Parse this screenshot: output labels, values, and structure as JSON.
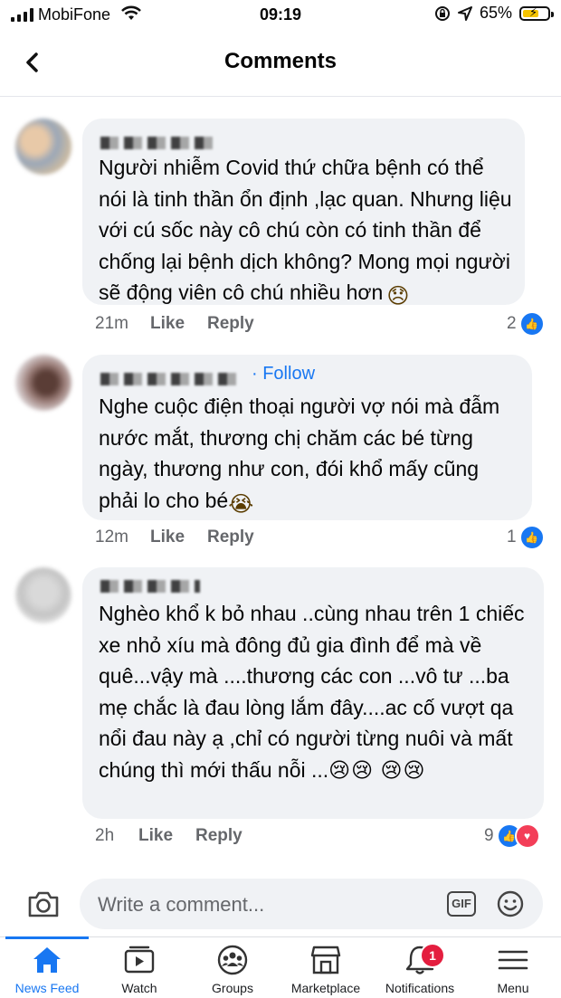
{
  "status_bar": {
    "carrier": "MobiFone",
    "time": "09:19",
    "battery": "65%",
    "battery_level": 0.65
  },
  "header": {
    "title": "Comments"
  },
  "comments": [
    {
      "text": "Người nhiễm Covid thứ chữa bệnh có thể nói là tinh thần ổn định ,lạc quan. Nhưng liệu với cú sốc này cô chú còn có tinh thần để chống lại bệnh dịch không? Mong mọi người sẽ động viên cô chú nhiều hơn",
      "emoji": "😞",
      "time": "21m",
      "like": "Like",
      "reply": "Reply",
      "reaction_count": "2",
      "reactions": [
        "like"
      ]
    },
    {
      "follow": "· Follow",
      "text": "Nghe cuộc điện thoại người vợ nói mà đẫm nước mắt, thương chị chăm các bé từng ngày, thương như con, đói khổ mấy cũng phải lo cho bé",
      "emoji": "😭",
      "time": "12m",
      "like": "Like",
      "reply": "Reply",
      "reaction_count": "1",
      "reactions": [
        "like"
      ]
    },
    {
      "text": "Nghèo khổ k bỏ nhau ..cùng nhau trên 1 chiếc xe nhỏ xíu mà đông đủ gia đình để mà về quê...vậy mà ....thương các con ...vô tư ...ba mẹ chắc là đau lòng lắm đây....ac cố vượt qa nổi đau này ạ ,chỉ có người từng nuôi và mất chúng thì mới thấu nỗi ...",
      "emoji": "😢😢 😢😢",
      "time": "2h",
      "like": "Like",
      "reply": "Reply",
      "reaction_count": "9",
      "reactions": [
        "like",
        "love"
      ]
    }
  ],
  "composer": {
    "placeholder": "Write a comment...",
    "gif": "GIF"
  },
  "tabs": [
    {
      "label": "News Feed",
      "icon": "home-icon",
      "active": true
    },
    {
      "label": "Watch",
      "icon": "watch-icon"
    },
    {
      "label": "Groups",
      "icon": "groups-icon"
    },
    {
      "label": "Marketplace",
      "icon": "marketplace-icon"
    },
    {
      "label": "Notifications",
      "icon": "bell-icon",
      "badge": "1"
    },
    {
      "label": "Menu",
      "icon": "menu-icon"
    }
  ],
  "colors": {
    "accent": "#1877f2",
    "badge": "#e41e3f",
    "bubble": "#f0f2f5"
  }
}
